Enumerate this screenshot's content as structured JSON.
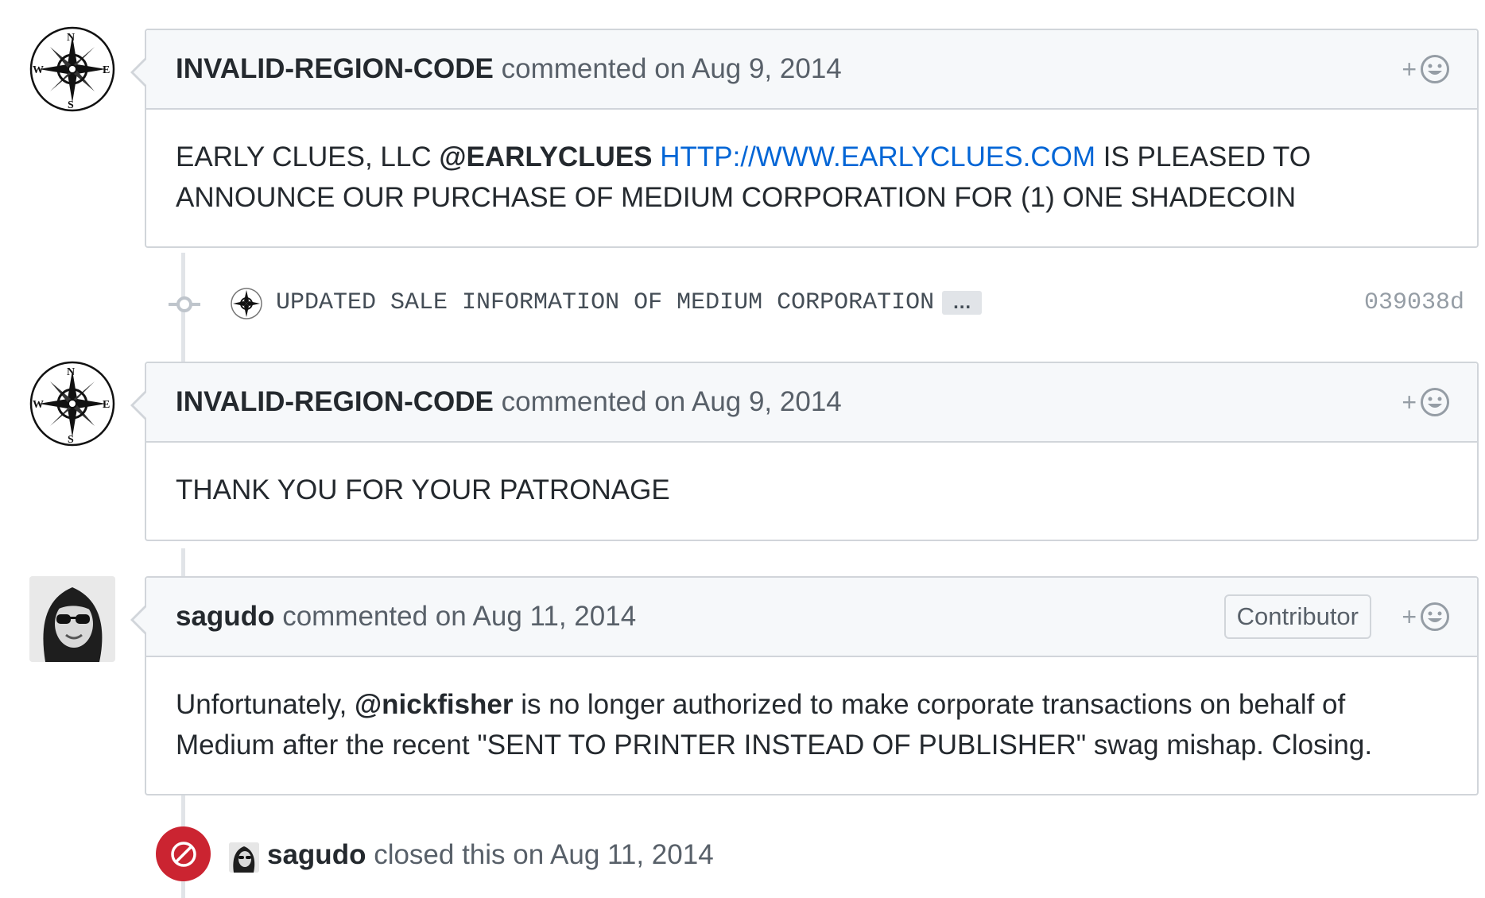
{
  "comments": [
    {
      "author": "INVALID-REGION-CODE",
      "action": "commented on",
      "date": "Aug 9, 2014",
      "avatar_icon": "compass-rose-icon",
      "body": {
        "part1": "EARLY CLUES, LLC ",
        "mention": "@EARLYCLUES",
        "part2": " ",
        "link": "HTTP://WWW.EARLYCLUES.COM",
        "part3": " IS PLEASED TO ANNOUNCE OUR PURCHASE OF MEDIUM CORPORATION FOR (1) ONE SHADECOIN"
      }
    },
    {
      "author": "INVALID-REGION-CODE",
      "action": "commented on",
      "date": "Aug 9, 2014",
      "avatar_icon": "compass-rose-icon",
      "body": {
        "text": "THANK YOU FOR YOUR PATRONAGE"
      }
    },
    {
      "author": "sagudo",
      "action": "commented on",
      "date": "Aug 11, 2014",
      "badge": "Contributor",
      "avatar_icon": "user-photo-avatar",
      "body": {
        "part1": "Unfortunately, ",
        "mention": "@nickfisher",
        "part2": " is no longer authorized to make corporate transactions on behalf of Medium after the recent \"SENT TO PRINTER INSTEAD OF PUBLISHER\" swag mishap. Closing."
      }
    }
  ],
  "commit": {
    "message": "UPDATED SALE INFORMATION OF MEDIUM CORPORATION",
    "ellipsis": "…",
    "sha": "039038d",
    "node_icon": "git-commit-icon"
  },
  "closed_event": {
    "author": "sagudo",
    "action": "closed this on",
    "date": "Aug 11, 2014",
    "icon": "circle-slash-icon"
  },
  "reaction": {
    "plus": "+",
    "icon": "smiley-icon"
  },
  "colors": {
    "link": "#0366d6",
    "closed_red": "#cb2431",
    "header_bg": "#f6f8fa",
    "border": "#d1d5da",
    "muted": "#586069"
  }
}
